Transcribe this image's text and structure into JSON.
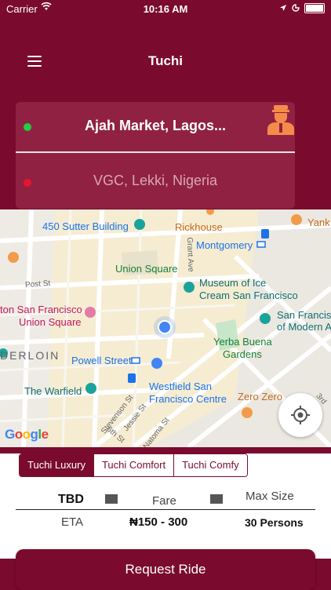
{
  "status_bar": {
    "carrier": "Carrier",
    "time": "10:16 AM"
  },
  "nav": {
    "title": "Tuchi",
    "menu_icon": "hamburger-menu-icon"
  },
  "locations": {
    "from": "Ajah Market, Lagos...",
    "to": "VGC, Lekki, Nigeria",
    "from_dot_color": "#22cc44",
    "to_dot_color": "#e8132f",
    "driver_icon": "driver-icon"
  },
  "map": {
    "labels": {
      "sutter": "450 Sutter Building",
      "rickhouse": "Rickhouse",
      "yank": "Yank",
      "montgomery": "Montgomery",
      "union_square": "Union Square",
      "museum1": "Museum of Ice",
      "museum2": "Cream San Francisco",
      "sf_union1": "ton San Francisco",
      "sf_union2": "Union Square",
      "sf_modern1": "San Francisc",
      "sf_modern2": "of Modern A",
      "yerba1": "Yerba Buena",
      "yerba2": "Gardens",
      "tenderloin": "DERLOIN",
      "powell": "Powell Street",
      "warfield": "The Warfield",
      "westfield1": "Westfield San",
      "westfield2": "Francisco Centre",
      "zero": "Zero Zero",
      "post_st": "Post St",
      "grant_ave": "Grant Ave",
      "stevenson": "Stevenson St",
      "jessie": "Jessie St",
      "sixth": "6th St",
      "natoma": "Natoma St",
      "third": "3rd"
    },
    "google_logo": "Google"
  },
  "tabs": [
    "Tuchi Luxury",
    "Tuchi Comfort",
    "Tuchi Comfy"
  ],
  "active_tab": 0,
  "info": {
    "tbd_label": "TBD",
    "fare_label": "Fare",
    "max_label": "Max Size",
    "eta_label": "ETA",
    "fare_value": "₦150 - 300",
    "max_value": "30 Persons"
  },
  "request_button": "Request Ride",
  "colors": {
    "brand": "#7a0b2e",
    "card": "#912142"
  }
}
